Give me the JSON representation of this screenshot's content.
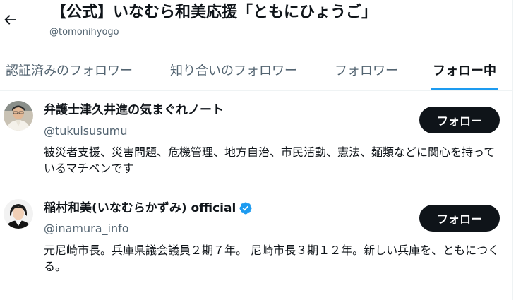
{
  "header": {
    "title": "【公式】いなむら和美応援「ともにひょうご」",
    "handle": "@tomonihyogo"
  },
  "tabs": [
    {
      "label": "認証済みのフォロワー",
      "active": false
    },
    {
      "label": "知り合いのフォロワー",
      "active": false
    },
    {
      "label": "フォロワー",
      "active": false
    },
    {
      "label": "フォロー中",
      "active": true
    }
  ],
  "users": [
    {
      "name": "弁護士津久井進の気まぐれノート",
      "handle": "@tukuisusumu",
      "verified": false,
      "bio": "被災者支援、災害問題、危機管理、地方自治、市民活動、憲法、麺類などに関心を持っているマチベンです",
      "follow_label": "フォロー"
    },
    {
      "name": "稲村和美(いなむらかずみ) official",
      "handle": "@inamura_info",
      "verified": true,
      "bio": "元尼崎市長。兵庫県議会議員２期７年。 尼崎市長３期１２年。新しい兵庫を、ともにつくる。",
      "follow_label": "フォロー"
    }
  ],
  "colors": {
    "accent": "#1d9bf0",
    "text_primary": "#0f1419",
    "text_secondary": "#536471",
    "button_bg": "#0f1419",
    "divider": "#eff3f4"
  },
  "icons": {
    "back": "arrow-left-icon",
    "verified": "verified-badge-icon"
  }
}
